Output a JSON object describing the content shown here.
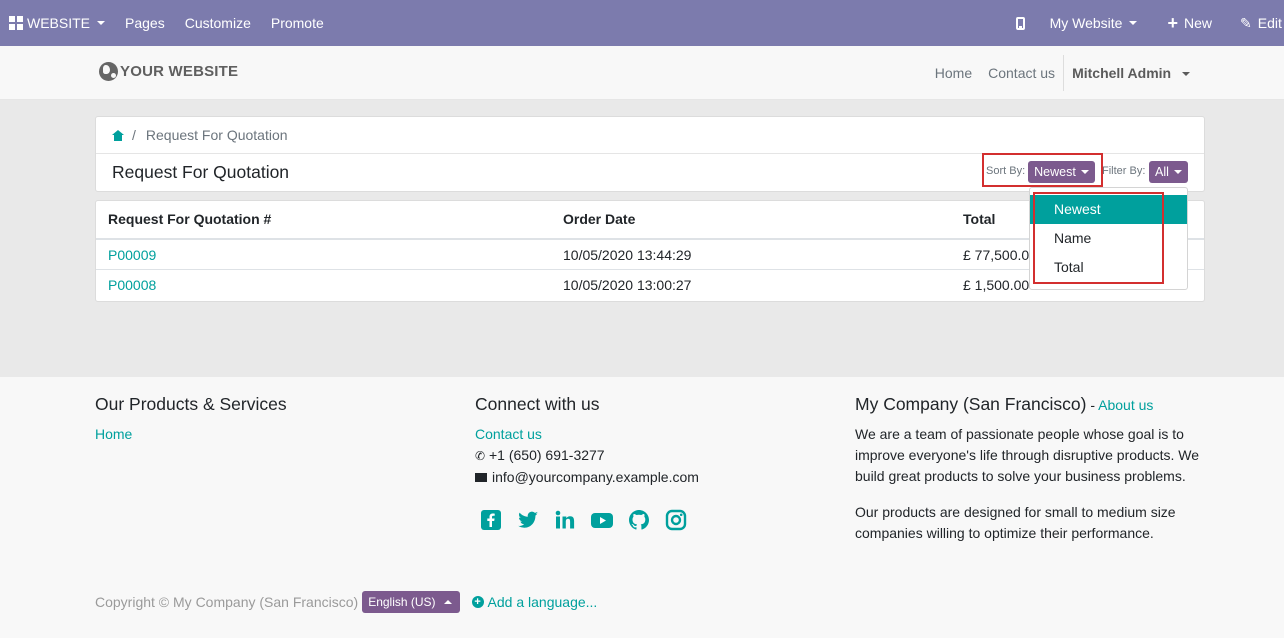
{
  "admin_bar": {
    "brand": "WEBSITE",
    "menu": [
      "Pages",
      "Customize",
      "Promote"
    ],
    "website_switch": "My Website",
    "new_label": "New",
    "edit_label": "Edit"
  },
  "site_header": {
    "logo": "YOUR WEBSITE",
    "nav": [
      "Home",
      "Contact us"
    ],
    "user": "Mitchell Admin"
  },
  "breadcrumb": {
    "current": "Request For Quotation",
    "separator": "/"
  },
  "page": {
    "title": "Request For Quotation",
    "sort_label": "Sort By:",
    "sort_value": "Newest",
    "filter_label": "Filter By:",
    "filter_value": "All"
  },
  "sort_dropdown": {
    "options": [
      "Newest",
      "Name",
      "Total"
    ],
    "selected": "Newest"
  },
  "table": {
    "columns": [
      "Request For Quotation #",
      "Order Date",
      "Total"
    ],
    "rows": [
      {
        "number": "P00009",
        "date": "10/05/2020 13:44:29",
        "total": "£ 77,500.00"
      },
      {
        "number": "P00008",
        "date": "10/05/2020 13:00:27",
        "total": "£ 1,500.00"
      }
    ]
  },
  "footer": {
    "products_title": "Our Products & Services",
    "products_link": "Home",
    "connect_title": "Connect with us",
    "contact_link": "Contact us",
    "phone": "+1 (650) 691-3277",
    "email": "info@yourcompany.example.com",
    "social_icons": [
      "facebook-icon",
      "twitter-icon",
      "linkedin-icon",
      "youtube-icon",
      "github-icon",
      "instagram-icon"
    ],
    "company_title": "My Company (San Francisco)",
    "company_dash": " - ",
    "about_link": "About us",
    "about_text_1": "We are a team of passionate people whose goal is to improve everyone's life through disruptive products. We build great products to solve your business problems.",
    "about_text_2": "Our products are designed for small to medium size companies willing to optimize their performance.",
    "copyright": "Copyright © My Company (San Francisco)",
    "language": "English (US)",
    "add_language": "Add a language..."
  },
  "colors": {
    "admin_bar": "#7c7bad",
    "accent": "#00a09d",
    "button": "#7c5a8e",
    "highlight": "#d32f2f"
  }
}
